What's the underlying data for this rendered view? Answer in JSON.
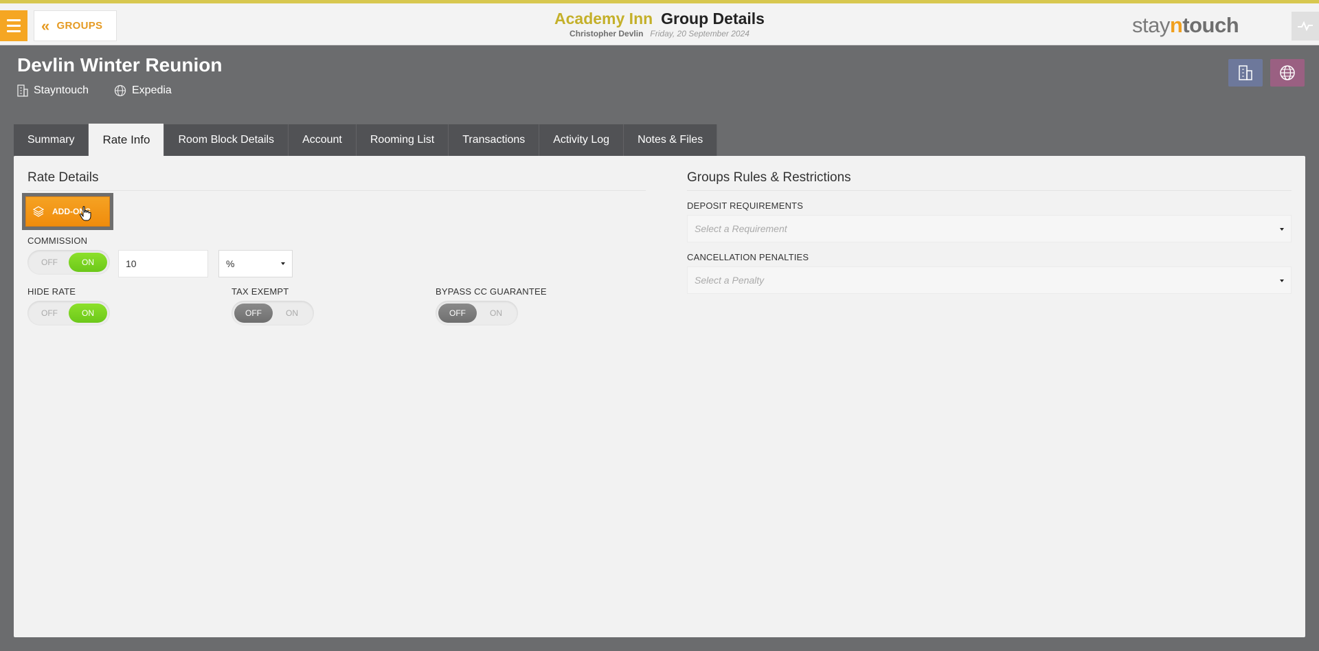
{
  "header": {
    "groups_label": "GROUPS",
    "hotel_name": "Academy Inn",
    "page_title": "Group Details",
    "user_name": "Christopher Devlin",
    "business_date": "Friday, 20 September 2024",
    "logo": {
      "stay": "stay",
      "n": "n",
      "touch": "touch"
    }
  },
  "group": {
    "name": "Devlin Winter Reunion",
    "company": "Stayntouch",
    "travel_agent": "Expedia"
  },
  "tabs": [
    {
      "label": "Summary"
    },
    {
      "label": "Rate Info",
      "active": true
    },
    {
      "label": "Room Block Details"
    },
    {
      "label": "Account"
    },
    {
      "label": "Rooming List"
    },
    {
      "label": "Transactions"
    },
    {
      "label": "Activity Log"
    },
    {
      "label": "Notes & Files"
    }
  ],
  "rate_details": {
    "title": "Rate Details",
    "addons_label": "ADD-ONS",
    "commission": {
      "label": "COMMISSION",
      "off_label": "OFF",
      "on_label": "ON",
      "state": "on",
      "value": "10",
      "unit": "%"
    },
    "hide_rate": {
      "label": "HIDE RATE",
      "off_label": "OFF",
      "on_label": "ON",
      "state": "on"
    },
    "tax_exempt": {
      "label": "TAX EXEMPT",
      "off_label": "OFF",
      "on_label": "ON",
      "state": "off"
    },
    "bypass_cc": {
      "label": "BYPASS CC GUARANTEE",
      "off_label": "OFF",
      "on_label": "ON",
      "state": "off"
    }
  },
  "rules": {
    "title": "Groups Rules & Restrictions",
    "deposit_label": "DEPOSIT REQUIREMENTS",
    "deposit_placeholder": "Select a Requirement",
    "cancellation_label": "CANCELLATION PENALTIES",
    "cancellation_placeholder": "Select a Penalty"
  },
  "colors": {
    "accent_orange": "#f5a623",
    "hotel_gold": "#c4b02a",
    "toggle_on": "#7ed321",
    "background": "#6b6c6e"
  }
}
